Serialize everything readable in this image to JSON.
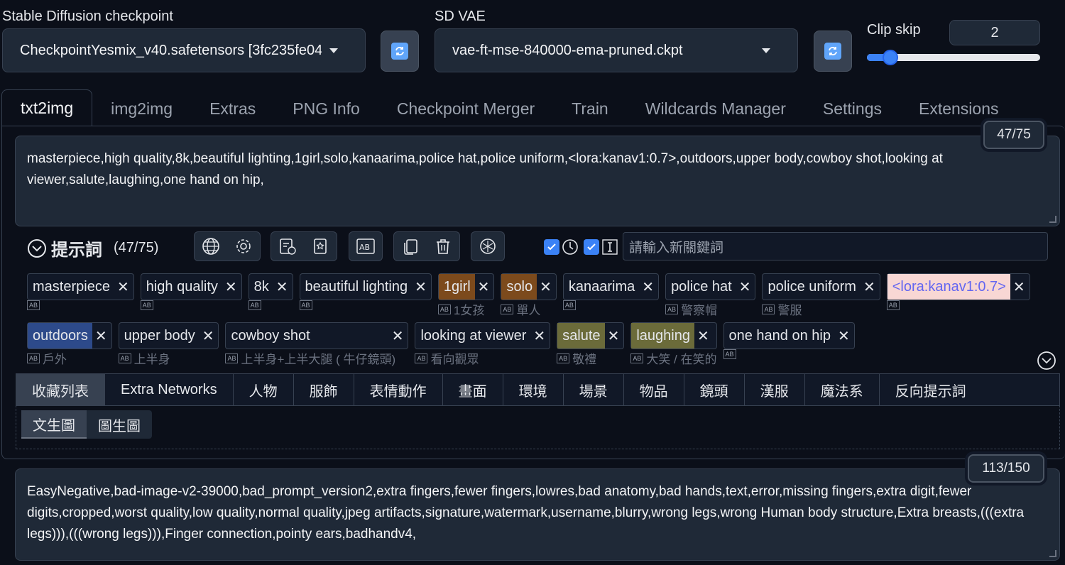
{
  "checkpoint": {
    "label": "Stable Diffusion checkpoint",
    "value": "CheckpointYesmix_v40.safetensors [3fc235fe04]"
  },
  "vae": {
    "label": "SD VAE",
    "value": "vae-ft-mse-840000-ema-pruned.ckpt"
  },
  "clip_skip": {
    "label": "Clip skip",
    "value": "2",
    "slider_fraction": 0.09
  },
  "tabs": [
    "txt2img",
    "img2img",
    "Extras",
    "PNG Info",
    "Checkpoint Merger",
    "Train",
    "Wildcards Manager",
    "Settings",
    "Extensions"
  ],
  "prompt": {
    "text": "masterpiece,high quality,8k,beautiful lighting,1girl,solo,kanaarima,police hat,police uniform,<lora:kanav1:0.7>,outdoors,upper body,cowboy shot,looking at viewer,salute,laughing,one hand on hip,",
    "counter": "47/75"
  },
  "tag_panel": {
    "title": "提示詞",
    "count": "(47/75)",
    "new_keyword_placeholder": "請輸入新關鍵詞"
  },
  "tags_row1": [
    {
      "text": "masterpiece",
      "trans": "",
      "style": ""
    },
    {
      "text": "high quality",
      "trans": "",
      "style": ""
    },
    {
      "text": "8k",
      "trans": "",
      "style": ""
    },
    {
      "text": "beautiful lighting",
      "trans": "",
      "style": ""
    },
    {
      "text": "1girl",
      "trans": "1女孩",
      "style": "orange"
    },
    {
      "text": "solo",
      "trans": "單人",
      "style": "orange"
    },
    {
      "text": "kanaarima",
      "trans": "",
      "style": ""
    },
    {
      "text": "police hat",
      "trans": "警察帽",
      "style": ""
    },
    {
      "text": "police uniform",
      "trans": "警服",
      "style": ""
    },
    {
      "text": "<lora:kanav1:0.7>",
      "trans": "",
      "style": "pink"
    }
  ],
  "tags_row2": [
    {
      "text": "outdoors",
      "trans": "戶外",
      "style": "blue"
    },
    {
      "text": "upper body",
      "trans": "上半身",
      "style": ""
    },
    {
      "text": "cowboy shot",
      "trans": "上半身+上半大腿 ( 牛仔鏡頭)",
      "style": ""
    },
    {
      "text": "looking at viewer",
      "trans": "看向觀眾",
      "style": ""
    },
    {
      "text": "salute",
      "trans": "敬禮",
      "style": "olive"
    },
    {
      "text": "laughing",
      "trans": "大笑 / 在笑的",
      "style": "olive"
    },
    {
      "text": "one hand on hip",
      "trans": "",
      "style": ""
    }
  ],
  "categories": [
    "收藏列表",
    "Extra Networks",
    "人物",
    "服飾",
    "表情動作",
    "畫面",
    "環境",
    "場景",
    "物品",
    "鏡頭",
    "漢服",
    "魔法系",
    "反向提示詞"
  ],
  "subtabs": [
    "文生圖",
    "圖生圖"
  ],
  "negative": {
    "text": "EasyNegative,bad-image-v2-39000,bad_prompt_version2,extra fingers,fewer fingers,lowres,bad anatomy,bad hands,text,error,missing fingers,extra digit,fewer digits,cropped,worst quality,low quality,normal quality,jpeg artifacts,signature,watermark,username,blurry,wrong legs,wrong Human body structure,Extra breasts,(((extra legs))),(((wrong legs))),Finger connection,pointy ears,badhandv4,",
    "counter": "113/150"
  },
  "icons": [
    "refresh-icon",
    "globe-icon",
    "gear-icon",
    "history-icon",
    "bookmark-icon",
    "translate-icon",
    "copy-icon",
    "trash-icon",
    "openai-icon",
    "clock-icon",
    "text-cursor-icon",
    "chevron-down-icon"
  ]
}
